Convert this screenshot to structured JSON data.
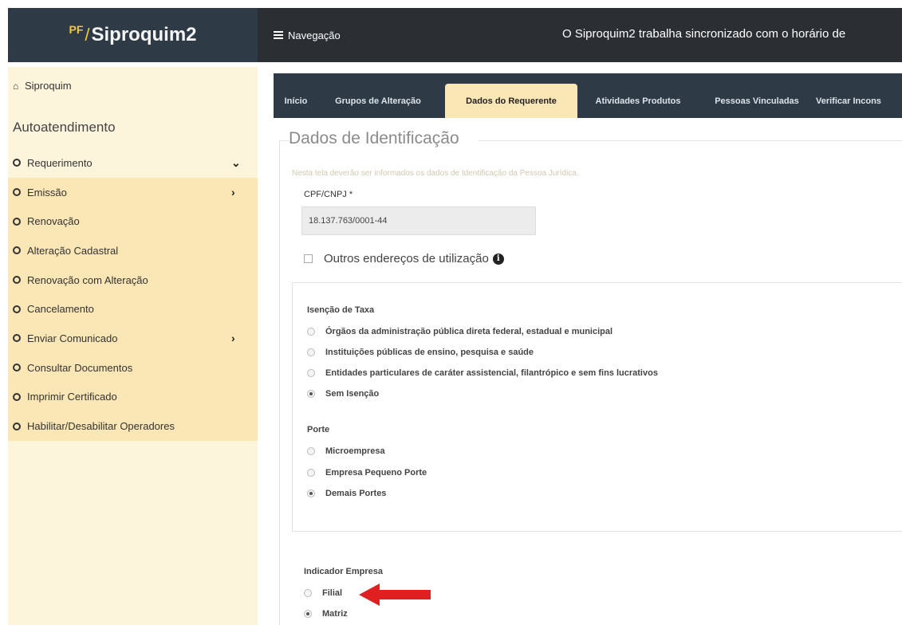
{
  "brand": {
    "prefix": "PF",
    "slash": "/",
    "name": "Siproquim2"
  },
  "topbar": {
    "nav_label": "Navegação",
    "message": "O Siproquim2 trabalha sincronizado com o horário de"
  },
  "sidebar": {
    "home_label": "Siproquim",
    "heading": "Autoatendimento",
    "items": [
      {
        "label": "Requerimento",
        "arrow": "⌄"
      },
      {
        "label": "Emissão",
        "arrow": "›"
      },
      {
        "label": "Renovação",
        "arrow": ""
      },
      {
        "label": "Alteração Cadastral",
        "arrow": ""
      },
      {
        "label": "Renovação com Alteração",
        "arrow": ""
      },
      {
        "label": "Cancelamento",
        "arrow": ""
      },
      {
        "label": "Enviar Comunicado",
        "arrow": "›"
      },
      {
        "label": "Consultar Documentos",
        "arrow": ""
      },
      {
        "label": "Imprimir Certificado",
        "arrow": ""
      },
      {
        "label": "Habilitar/Desabilitar Operadores",
        "arrow": ""
      }
    ]
  },
  "tabs": [
    "Início",
    "Grupos de Alteração",
    "Dados do Requerente",
    "Atividades Produtos",
    "Pessoas Vinculadas",
    "Verificar Incons"
  ],
  "active_tab": "Dados do Requerente",
  "form": {
    "section_title": "Dados de Identificação",
    "hint": "Nesta tela deverão ser informados os dados de Identificação da Pessoa Jurídica.",
    "cnpj_label": "CPF/CNPJ *",
    "cnpj_value": "18.137.763/0001-44",
    "other_addresses_label": "Outros endereços de utilização",
    "other_addresses_checked": false,
    "isencao": {
      "label": "Isenção de Taxa",
      "options": [
        "Órgãos da administração pública direta federal, estadual e municipal",
        "Instituições públicas de ensino, pesquisa e saúde",
        "Entidades particulares de caráter assistencial, filantrópico e sem fins lucrativos",
        "Sem Isenção"
      ],
      "selected": "Sem Isenção"
    },
    "porte": {
      "label": "Porte",
      "options": [
        "Microempresa",
        "Empresa Pequeno Porte",
        "Demais Portes"
      ],
      "selected": "Demais Portes"
    },
    "indicador": {
      "label": "Indicador Empresa",
      "options": [
        "Filial",
        "Matriz"
      ],
      "selected": "Matriz"
    }
  },
  "colors": {
    "topbar": "#2b2f34",
    "brand_bg": "#2e3a45",
    "sidebar_bg": "#fdf4dc",
    "sidebar_highlight": "#fbe7b5",
    "active_tab": "#fbe7b5",
    "annotation_arrow": "#e02020"
  }
}
